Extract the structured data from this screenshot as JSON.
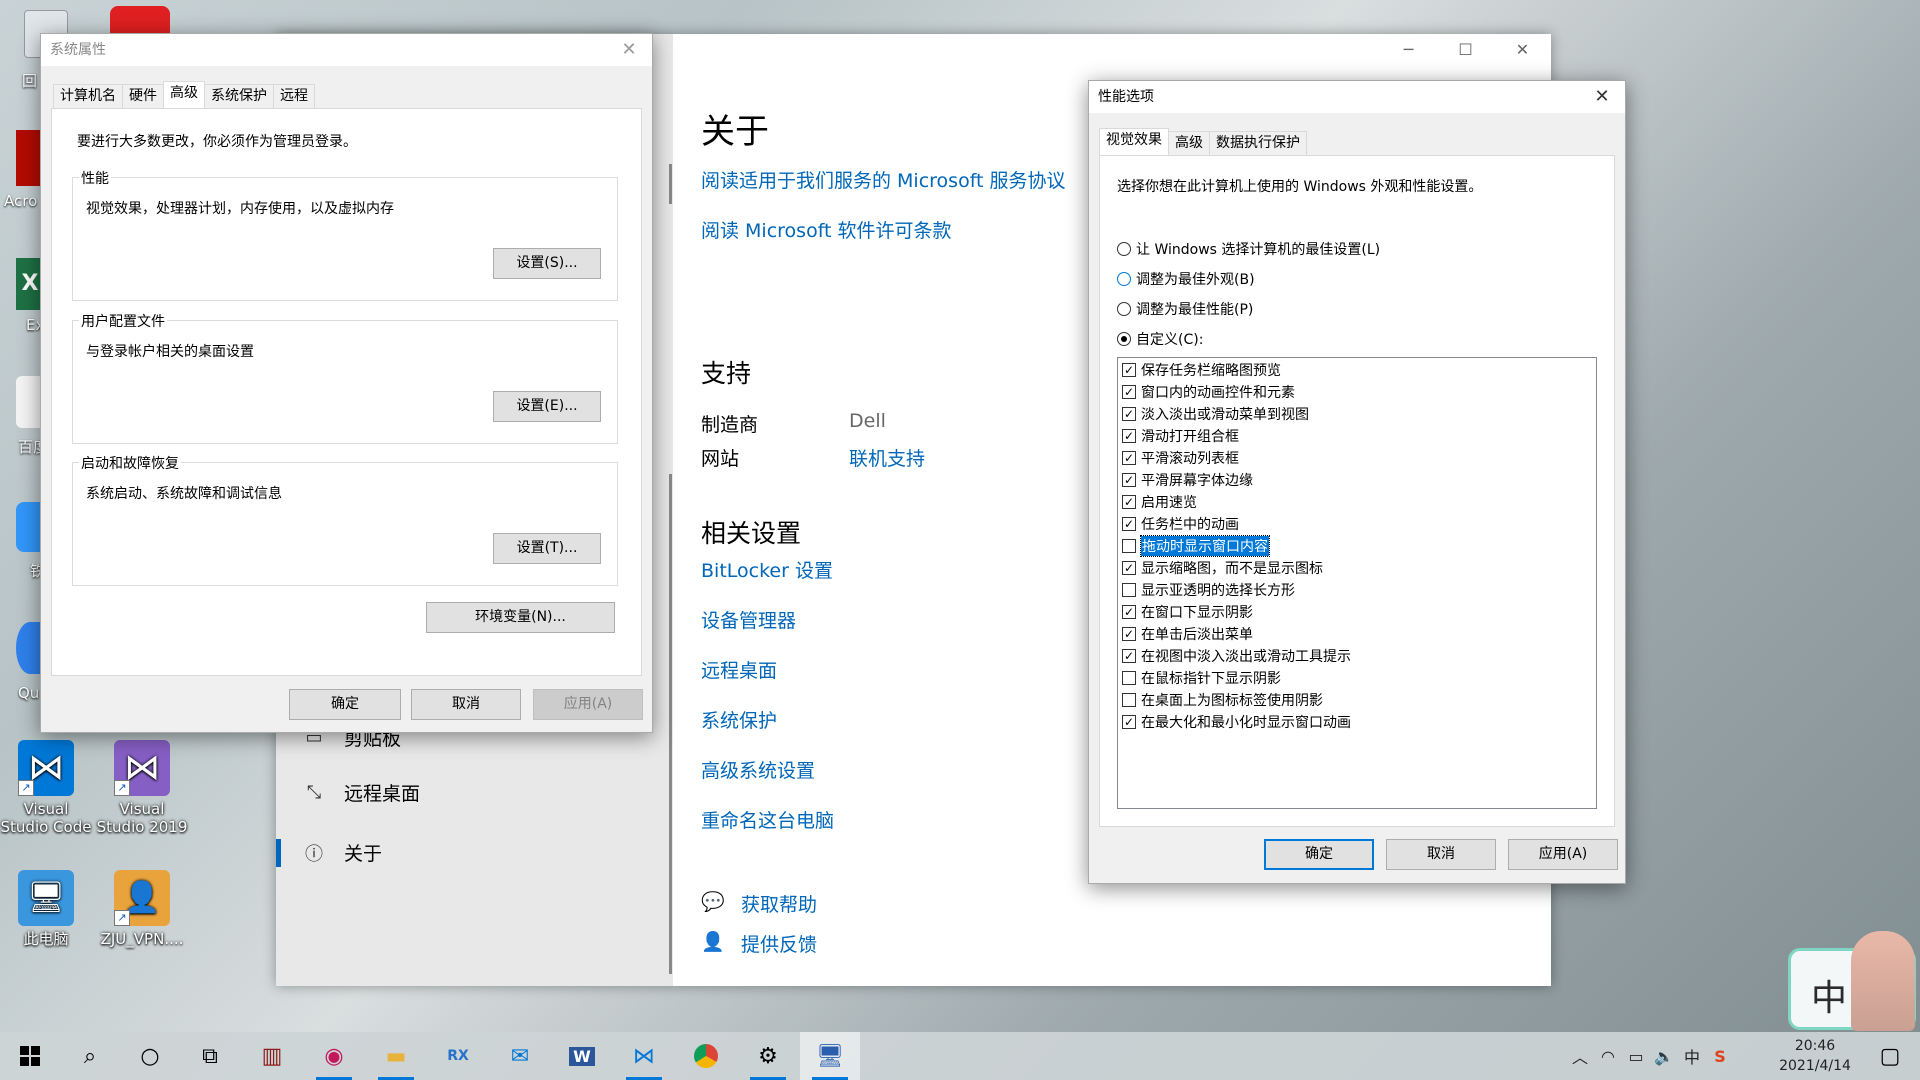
{
  "desktop": {
    "icons": [
      {
        "label": "Visual Studio Code",
        "color": "#0078d7",
        "glyph": "⋈"
      },
      {
        "label": "Visual Studio 2019",
        "color": "#865fc5",
        "glyph": "⋈"
      },
      {
        "label": "此电脑",
        "color": "#3a96dd",
        "glyph": "🖥"
      },
      {
        "label": "ZJU_VPN....",
        "color": "#e8a33d",
        "glyph": "👤"
      }
    ],
    "partial_labels": [
      "回",
      "Acro",
      "Ex",
      "百度",
      "铁",
      "Qu"
    ]
  },
  "settings": {
    "nav": {
      "clipboard": "剪贴板",
      "remote": "远程桌面",
      "about": "关于"
    },
    "main": {
      "title": "关于",
      "link1": "阅读适用于我们服务的 Microsoft 服务协议",
      "link2": "阅读 Microsoft 软件许可条款",
      "support_title": "支持",
      "manufacturer_label": "制造商",
      "manufacturer_value": "Dell",
      "website_label": "网站",
      "website_value": "联机支持",
      "related_title": "相关设置",
      "related": [
        "BitLocker 设置",
        "设备管理器",
        "远程桌面",
        "系统保护",
        "高级系统设置",
        "重命名这台电脑"
      ],
      "help": "获取帮助",
      "feedback": "提供反馈"
    }
  },
  "sysprops": {
    "title": "系统属性",
    "tabs": [
      "计算机名",
      "硬件",
      "高级",
      "系统保护",
      "远程"
    ],
    "active_tab": "高级",
    "admin_note": "要进行大多数更改，你必须作为管理员登录。",
    "perf_label": "性能",
    "perf_desc": "视觉效果，处理器计划，内存使用，以及虚拟内存",
    "perf_btn": "设置(S)...",
    "profile_label": "用户配置文件",
    "profile_desc": "与登录帐户相关的桌面设置",
    "profile_btn": "设置(E)...",
    "startup_label": "启动和故障恢复",
    "startup_desc": "系统启动、系统故障和调试信息",
    "startup_btn": "设置(T)...",
    "env_btn": "环境变量(N)...",
    "ok": "确定",
    "cancel": "取消",
    "apply": "应用(A)"
  },
  "perf": {
    "title": "性能选项",
    "tabs": [
      "视觉效果",
      "高级",
      "数据执行保护"
    ],
    "active_tab": "视觉效果",
    "intro": "选择你想在此计算机上使用的 Windows 外观和性能设置。",
    "radios": [
      {
        "label": "让 Windows 选择计算机的最佳设置(L)",
        "checked": false
      },
      {
        "label": "调整为最佳外观(B)",
        "checked": false
      },
      {
        "label": "调整为最佳性能(P)",
        "checked": false
      },
      {
        "label": "自定义(C):",
        "checked": true
      }
    ],
    "options": [
      {
        "label": "保存任务栏缩略图预览",
        "checked": true
      },
      {
        "label": "窗口内的动画控件和元素",
        "checked": true
      },
      {
        "label": "淡入淡出或滑动菜单到视图",
        "checked": true
      },
      {
        "label": "滑动打开组合框",
        "checked": true
      },
      {
        "label": "平滑滚动列表框",
        "checked": true
      },
      {
        "label": "平滑屏幕字体边缘",
        "checked": true
      },
      {
        "label": "启用速览",
        "checked": true
      },
      {
        "label": "任务栏中的动画",
        "checked": true
      },
      {
        "label": "拖动时显示窗口内容",
        "checked": false
      },
      {
        "label": "显示缩略图，而不是显示图标",
        "checked": true
      },
      {
        "label": "显示亚透明的选择长方形",
        "checked": false
      },
      {
        "label": "在窗口下显示阴影",
        "checked": true
      },
      {
        "label": "在单击后淡出菜单",
        "checked": true
      },
      {
        "label": "在视图中淡入淡出或滑动工具提示",
        "checked": true
      },
      {
        "label": "在鼠标指针下显示阴影",
        "checked": false
      },
      {
        "label": "在桌面上为图标标签使用阴影",
        "checked": false
      },
      {
        "label": "在最大化和最小化时显示窗口动画",
        "checked": true
      }
    ],
    "selected_option": "拖动时显示窗口内容",
    "ok": "确定",
    "cancel": "取消",
    "apply": "应用(A)"
  },
  "taskbar": {
    "time": "20:46",
    "date": "2021/4/14",
    "ime": "中",
    "widget_char": "中"
  }
}
